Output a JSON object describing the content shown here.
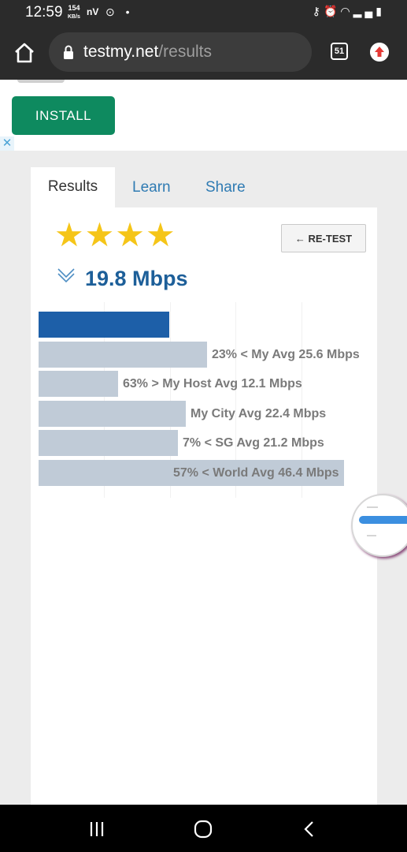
{
  "status_bar": {
    "time": "12:59",
    "net_speed_value": "154",
    "net_speed_unit": "KB/s",
    "carrier_label": "nV"
  },
  "browser": {
    "url_domain": "testmy.net",
    "url_path": "/results",
    "tab_count": "51"
  },
  "ad": {
    "install_label": "INSTALL",
    "close_label": "✕"
  },
  "tabs": {
    "results": "Results",
    "learn": "Learn",
    "share": "Share"
  },
  "result": {
    "rating_stars": 4,
    "stars_text": "★★★★",
    "retest_label": "← RE-TEST",
    "speed": "19.8 Mbps"
  },
  "chart_data": {
    "type": "bar",
    "orientation": "horizontal",
    "unit": "Mbps",
    "bars": [
      {
        "label": "",
        "value": 19.8
      },
      {
        "label": "23% < My Avg 25.6 Mbps",
        "value": 25.6
      },
      {
        "label": "63% > My Host Avg 12.1 Mbps",
        "value": 12.1
      },
      {
        "label": "My City Avg 22.4 Mbps",
        "value": 22.4
      },
      {
        "label": "7% < SG Avg 21.2 Mbps",
        "value": 21.2
      },
      {
        "label": "57% < World Avg 46.4 Mbps",
        "value": 46.4
      }
    ],
    "colors": {
      "yours": "#1d5fa8",
      "others": "#c0cbd7"
    }
  },
  "colors": {
    "accent": "#1d5f99",
    "install": "#0e8a5f",
    "stars": "#f5c518"
  }
}
